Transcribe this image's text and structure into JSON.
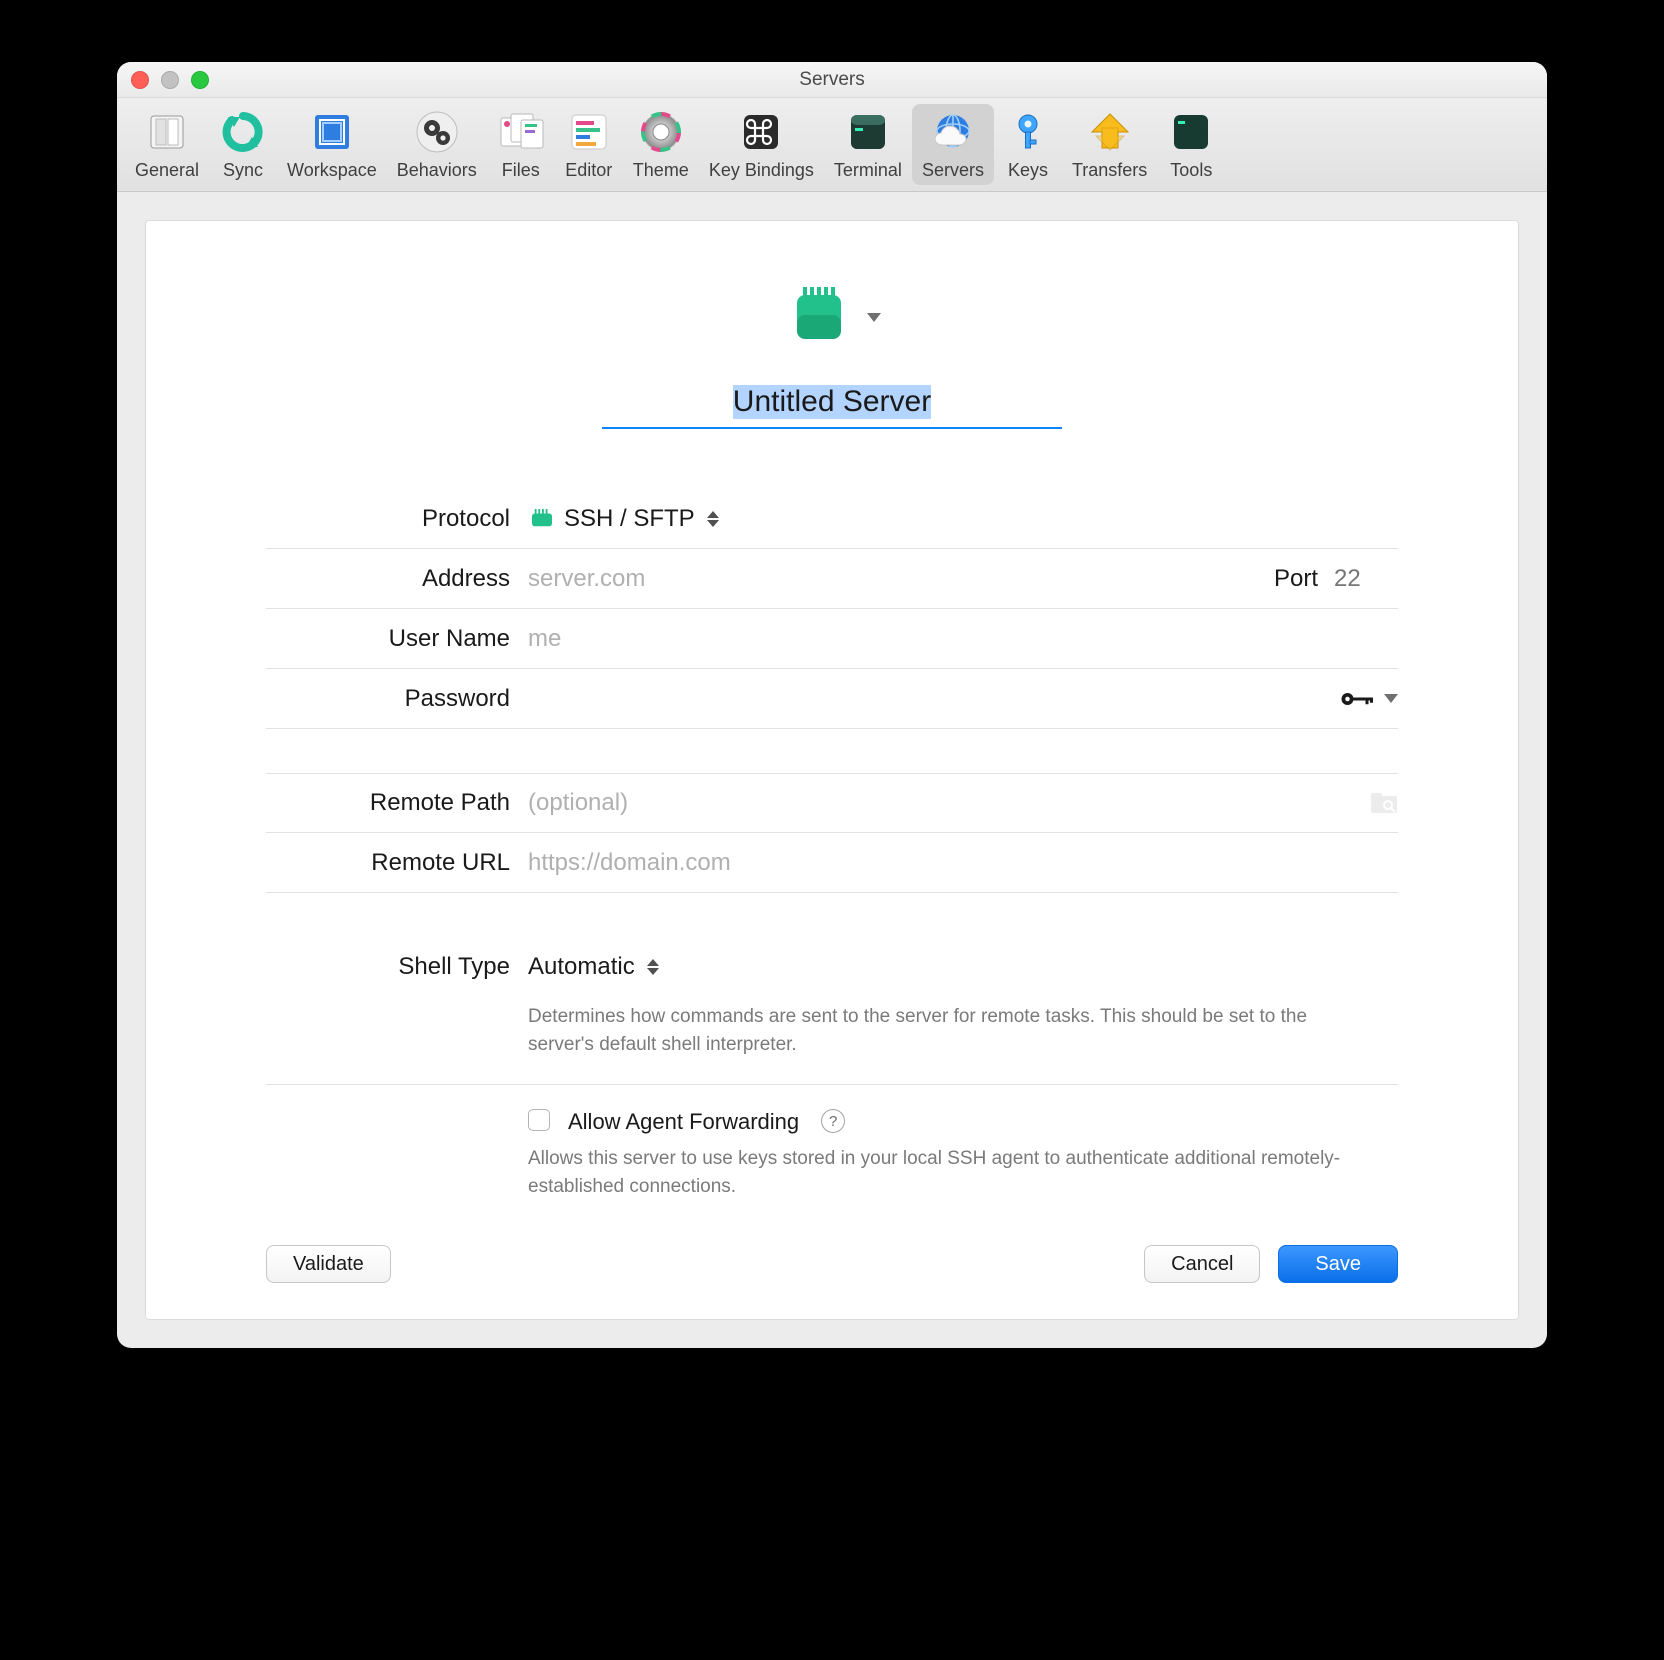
{
  "window": {
    "title": "Servers"
  },
  "toolbar": {
    "items": [
      {
        "label": "General"
      },
      {
        "label": "Sync"
      },
      {
        "label": "Workspace"
      },
      {
        "label": "Behaviors"
      },
      {
        "label": "Files"
      },
      {
        "label": "Editor"
      },
      {
        "label": "Theme"
      },
      {
        "label": "Key Bindings"
      },
      {
        "label": "Terminal"
      },
      {
        "label": "Servers"
      },
      {
        "label": "Keys"
      },
      {
        "label": "Transfers"
      },
      {
        "label": "Tools"
      }
    ],
    "selected_index": 9
  },
  "server": {
    "name": "Untitled Server",
    "protocol_label": "Protocol",
    "protocol_value": "SSH / SFTP",
    "address_label": "Address",
    "address_placeholder": "server.com",
    "port_label": "Port",
    "port_placeholder": "22",
    "username_label": "User Name",
    "username_placeholder": "me",
    "password_label": "Password",
    "remote_path_label": "Remote Path",
    "remote_path_placeholder": "(optional)",
    "remote_url_label": "Remote URL",
    "remote_url_placeholder": "https://domain.com",
    "shell_type_label": "Shell Type",
    "shell_type_value": "Automatic",
    "shell_type_desc": "Determines how commands are sent to the server for remote tasks. This should be set to the server's default shell interpreter.",
    "agent_fwd_label": "Allow Agent Forwarding",
    "agent_fwd_help": "?",
    "agent_fwd_desc": "Allows this server to use keys stored in your local SSH agent to authenticate additional remotely-established connections."
  },
  "buttons": {
    "validate": "Validate",
    "cancel": "Cancel",
    "save": "Save"
  }
}
